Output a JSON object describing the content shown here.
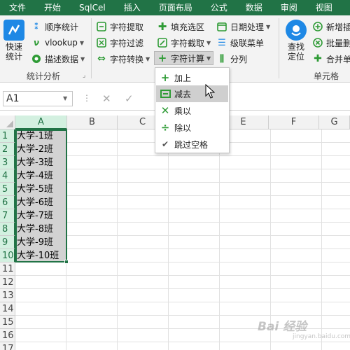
{
  "menubar": {
    "items": [
      "文件",
      "开始",
      "SqlCel",
      "插入",
      "页面布局",
      "公式",
      "数据",
      "审阅",
      "视图"
    ]
  },
  "ribbon": {
    "quick_stats": "快速\n统计",
    "seq_stats": "顺序统计",
    "vlookup": "vlookup",
    "describe": "描述数据",
    "group_stats": "统计分析",
    "char_extract": "字符提取",
    "char_filter": "字符过滤",
    "char_convert": "字符转换",
    "fill_select": "填充选区",
    "char_cut": "字符截取",
    "char_calc": "字符计算",
    "date_proc": "日期处理",
    "cascade_menu": "级联菜单",
    "split_col": "分列",
    "find_locate": "查找\n定位",
    "new_insert": "新增插",
    "batch_delete": "批量删",
    "merge_cells": "合并单",
    "group_cells": "单元格"
  },
  "formula_bar": {
    "name_box": "A1",
    "dots": "⋮",
    "cancel": "✕",
    "enter": "✓"
  },
  "sheet": {
    "columns": [
      "A",
      "B",
      "C",
      "D",
      "E",
      "F",
      "G"
    ],
    "rows": [
      "1",
      "2",
      "3",
      "4",
      "5",
      "6",
      "7",
      "8",
      "9",
      "10",
      "11",
      "12",
      "13",
      "14",
      "15",
      "16",
      "17"
    ],
    "cells_A": [
      "大学-1班",
      "大学-2班",
      "大学-3班",
      "大学-4班",
      "大学-5班",
      "大学-6班",
      "大学-7班",
      "大学-8班",
      "大学-9班",
      "大学-10班"
    ]
  },
  "dropdown": {
    "items": [
      {
        "label": "加上",
        "icon": "plus-icon"
      },
      {
        "label": "减去",
        "icon": "minus-box-icon"
      },
      {
        "label": "乘以",
        "icon": "times-icon"
      },
      {
        "label": "除以",
        "icon": "divide-icon"
      },
      {
        "label": "跳过空格",
        "icon": "check-icon"
      }
    ]
  },
  "watermark": {
    "text": "Bai 经验",
    "sub": "jingyan.baidu.com"
  },
  "colors": {
    "brand_green": "#217346",
    "icon_green": "#2e9b35",
    "icon_blue": "#1e88e5",
    "selection_gray": "#d2d2d2"
  }
}
